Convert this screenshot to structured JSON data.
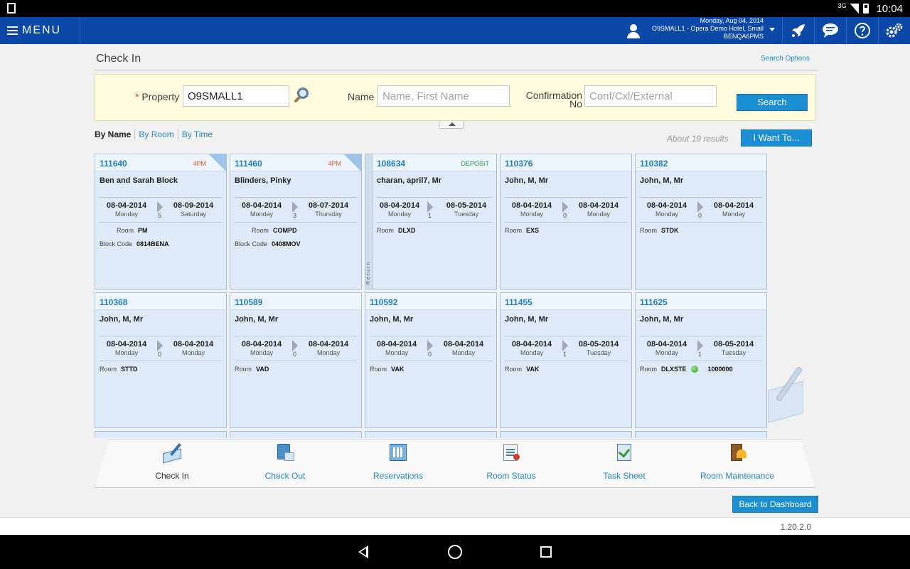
{
  "statusbar": {
    "network": "3G",
    "time": "10:04"
  },
  "header": {
    "menu_label": "MENU",
    "user_date": "Monday, Aug 04, 2014",
    "user_property": "O9SMALL1 - Opera Demo Hotel, Small",
    "user_id": "BENQA6PMS"
  },
  "page": {
    "title": "Check In",
    "search_options": "Search Options"
  },
  "search": {
    "property_label": "Property",
    "property_required": "*",
    "property_value": "O9SMALL1",
    "name_label": "Name",
    "name_placeholder": "Name, First Name",
    "confirmation_label_1": "Confirmation",
    "confirmation_label_2": "No",
    "confirmation_placeholder": "Conf/Cxl/External",
    "search_button": "Search"
  },
  "tabs": [
    "By Name",
    "By Room",
    "By Time"
  ],
  "results_text": "About 19 results",
  "iwant_button": "I Want To...",
  "cards": [
    {
      "no": "111640",
      "tag": "4PM",
      "name": "Ben and Sarah Block",
      "arrive": "08-04-2014",
      "arrive_day": "Monday",
      "nights": "5",
      "depart": "08-09-2014",
      "depart_day": "Saturday",
      "room_label": "Room",
      "room": "PM",
      "block_label": "Block Code",
      "block": "0814BENA"
    },
    {
      "no": "111460",
      "tag": "4PM",
      "name": "Blinders, Pinky",
      "arrive": "08-04-2014",
      "arrive_day": "Monday",
      "nights": "3",
      "depart": "08-07-2014",
      "depart_day": "Thursday",
      "room_label": "Room",
      "room": "COMPD",
      "block_label": "Block Code",
      "block": "0408MOV"
    },
    {
      "no": "108634",
      "tag": "DEPOSIT",
      "name": "charan, april7, Mr",
      "arrive": "08-04-2014",
      "arrive_day": "Monday",
      "nights": "1",
      "depart": "08-05-2014",
      "depart_day": "Tuesday",
      "room_label": "Room",
      "room": "DLXD",
      "return_label": "Return"
    },
    {
      "no": "110376",
      "name": "John, M, Mr",
      "arrive": "08-04-2014",
      "arrive_day": "Monday",
      "nights": "0",
      "depart": "08-04-2014",
      "depart_day": "Monday",
      "room_label": "Room",
      "room": "EXS"
    },
    {
      "no": "110382",
      "name": "John, M, Mr",
      "arrive": "08-04-2014",
      "arrive_day": "Monday",
      "nights": "0",
      "depart": "08-04-2014",
      "depart_day": "Monday",
      "room_label": "Room",
      "room": "STDK"
    },
    {
      "no": "110368",
      "name": "John, M, Mr",
      "arrive": "08-04-2014",
      "arrive_day": "Monday",
      "nights": "0",
      "depart": "08-04-2014",
      "depart_day": "Monday",
      "room_label": "Room",
      "room": "STTD"
    },
    {
      "no": "110589",
      "name": "John, M, Mr",
      "arrive": "08-04-2014",
      "arrive_day": "Monday",
      "nights": "0",
      "depart": "08-04-2014",
      "depart_day": "Monday",
      "room_label": "Room",
      "room": "VAD"
    },
    {
      "no": "110592",
      "name": "John, M, Mr",
      "arrive": "08-04-2014",
      "arrive_day": "Monday",
      "nights": "0",
      "depart": "08-04-2014",
      "depart_day": "Monday",
      "room_label": "Room",
      "room": "VAK"
    },
    {
      "no": "111455",
      "name": "John, M, Mr",
      "arrive": "08-04-2014",
      "arrive_day": "Monday",
      "nights": "1",
      "depart": "08-05-2014",
      "depart_day": "Tuesday",
      "room_label": "Room",
      "room": "VAK"
    },
    {
      "no": "111625",
      "name": "John, M, Mr",
      "arrive": "08-04-2014",
      "arrive_day": "Monday",
      "nights": "1",
      "depart": "08-05-2014",
      "depart_day": "Tuesday",
      "room_label": "Room",
      "room": "DLXSTE",
      "room_status": "clean",
      "extra": "1000000"
    }
  ],
  "bottom_nav": [
    "Check In",
    "Check Out",
    "Reservations",
    "Room Status",
    "Task Sheet",
    "Room Maintenance"
  ],
  "back_button": "Back to Dashboard",
  "version": "1.20.2.0",
  "colors": {
    "brand": "#0b48a8",
    "accent": "#1b8fd1",
    "card": "#ddeaf7",
    "panel": "#fefbde"
  }
}
